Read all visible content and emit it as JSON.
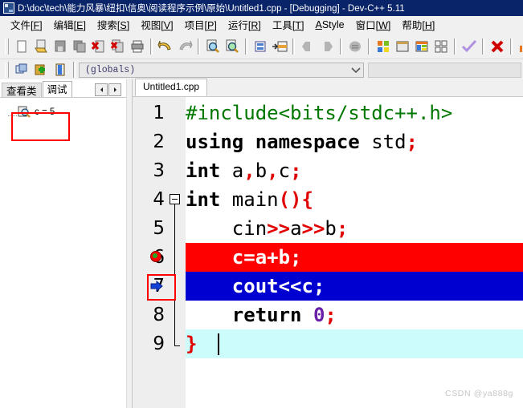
{
  "window": {
    "title": "D:\\doc\\tech\\能力风暴\\纽扣\\信奥\\阅读程序示例\\原始\\Untitled1.cpp - [Debugging] - Dev-C++ 5.11",
    "app_icon": "devcpp-icon"
  },
  "menubar": {
    "items": [
      {
        "label": "文件",
        "accel": "F"
      },
      {
        "label": "编辑",
        "accel": "E"
      },
      {
        "label": "搜索",
        "accel": "S"
      },
      {
        "label": "视图",
        "accel": "V"
      },
      {
        "label": "项目",
        "accel": "P"
      },
      {
        "label": "运行",
        "accel": "R"
      },
      {
        "label": "工具",
        "accel": "T"
      },
      {
        "label": "AStyle",
        "accel": "A"
      },
      {
        "label": "窗口",
        "accel": "W"
      },
      {
        "label": "帮助",
        "accel": "H"
      }
    ]
  },
  "toolbar_main": {
    "icons": [
      "new-file-icon",
      "open-file-icon",
      "save-file-icon",
      "save-all-icon",
      "close-file-icon",
      "close-all-icon",
      "print-icon",
      "undo-icon",
      "redo-icon",
      "find-icon",
      "replace-icon",
      "goto-line-icon",
      "goto-function-icon",
      "back-icon",
      "forward-icon",
      "toggle-icon",
      "compile-icon",
      "run-icon",
      "compile-run-icon",
      "rebuild-icon",
      "check-syntax-icon",
      "stop-execution-icon",
      "profile-icon",
      "debug-icon"
    ]
  },
  "toolbar_secondary": {
    "icons": [
      "project-icon",
      "add-item-icon",
      "class-browser-icon"
    ],
    "scope_combo": {
      "value": "(globals)",
      "arrow_icon": "chevron-down-icon"
    }
  },
  "left_panel": {
    "tabs": [
      {
        "label": "查看类",
        "active": false
      },
      {
        "label": "调试",
        "active": true
      }
    ],
    "spin_buttons": [
      "scroll-left-icon",
      "scroll-right-icon"
    ],
    "watch": {
      "icon": "watch-inspect-icon",
      "expression": "c = 5",
      "highlight_color": "#ff0000"
    }
  },
  "editor": {
    "tabs": [
      {
        "label": "Untitled1.cpp",
        "active": true
      }
    ],
    "gutter": {
      "fold_start_line": 4,
      "fold_end_line": 9,
      "breakpoint_line": 6,
      "current_line_marker": 7,
      "current_line_marker_icon": "execution-arrow-icon",
      "highlight_box_line": 7,
      "highlight_box_color": "#ff0000"
    },
    "lines": [
      {
        "num": "1",
        "highlight": "none",
        "tokens": [
          {
            "t": "#include<bits/stdc++.h>",
            "c": "inc"
          }
        ]
      },
      {
        "num": "2",
        "highlight": "none",
        "tokens": [
          {
            "t": "using namespace",
            "c": "k"
          },
          {
            "t": " std",
            "c": "pl"
          },
          {
            "t": ";",
            "c": "pun"
          }
        ]
      },
      {
        "num": "3",
        "highlight": "none",
        "tokens": [
          {
            "t": "int",
            "c": "k"
          },
          {
            "t": " a",
            "c": "pl"
          },
          {
            "t": ",",
            "c": "pun"
          },
          {
            "t": "b",
            "c": "pl"
          },
          {
            "t": ",",
            "c": "pun"
          },
          {
            "t": "c",
            "c": "pl"
          },
          {
            "t": ";",
            "c": "pun"
          }
        ]
      },
      {
        "num": "4",
        "highlight": "none",
        "tokens": [
          {
            "t": "int",
            "c": "k"
          },
          {
            "t": " main",
            "c": "pl"
          },
          {
            "t": "(){",
            "c": "pun"
          }
        ]
      },
      {
        "num": "5",
        "highlight": "none",
        "tokens": [
          {
            "t": "    cin",
            "c": "pl"
          },
          {
            "t": ">>",
            "c": "pun"
          },
          {
            "t": "a",
            "c": "pl"
          },
          {
            "t": ">>",
            "c": "pun"
          },
          {
            "t": "b",
            "c": "pl"
          },
          {
            "t": ";",
            "c": "pun"
          }
        ]
      },
      {
        "num": "6",
        "highlight": "red",
        "tokens": [
          {
            "t": "    c=a+b;",
            "c": "wht"
          }
        ]
      },
      {
        "num": "7",
        "highlight": "blue",
        "tokens": [
          {
            "t": "    cout<<c;",
            "c": "wht"
          }
        ]
      },
      {
        "num": "8",
        "highlight": "none",
        "tokens": [
          {
            "t": "    return",
            "c": "k"
          },
          {
            "t": " ",
            "c": "pl"
          },
          {
            "t": "0",
            "c": "num"
          },
          {
            "t": ";",
            "c": "pun"
          }
        ]
      },
      {
        "num": "9",
        "highlight": "cyan",
        "tokens": [
          {
            "t": "}",
            "c": "pun"
          }
        ]
      }
    ]
  },
  "watermark": {
    "text": "CSDN @ya888g"
  }
}
